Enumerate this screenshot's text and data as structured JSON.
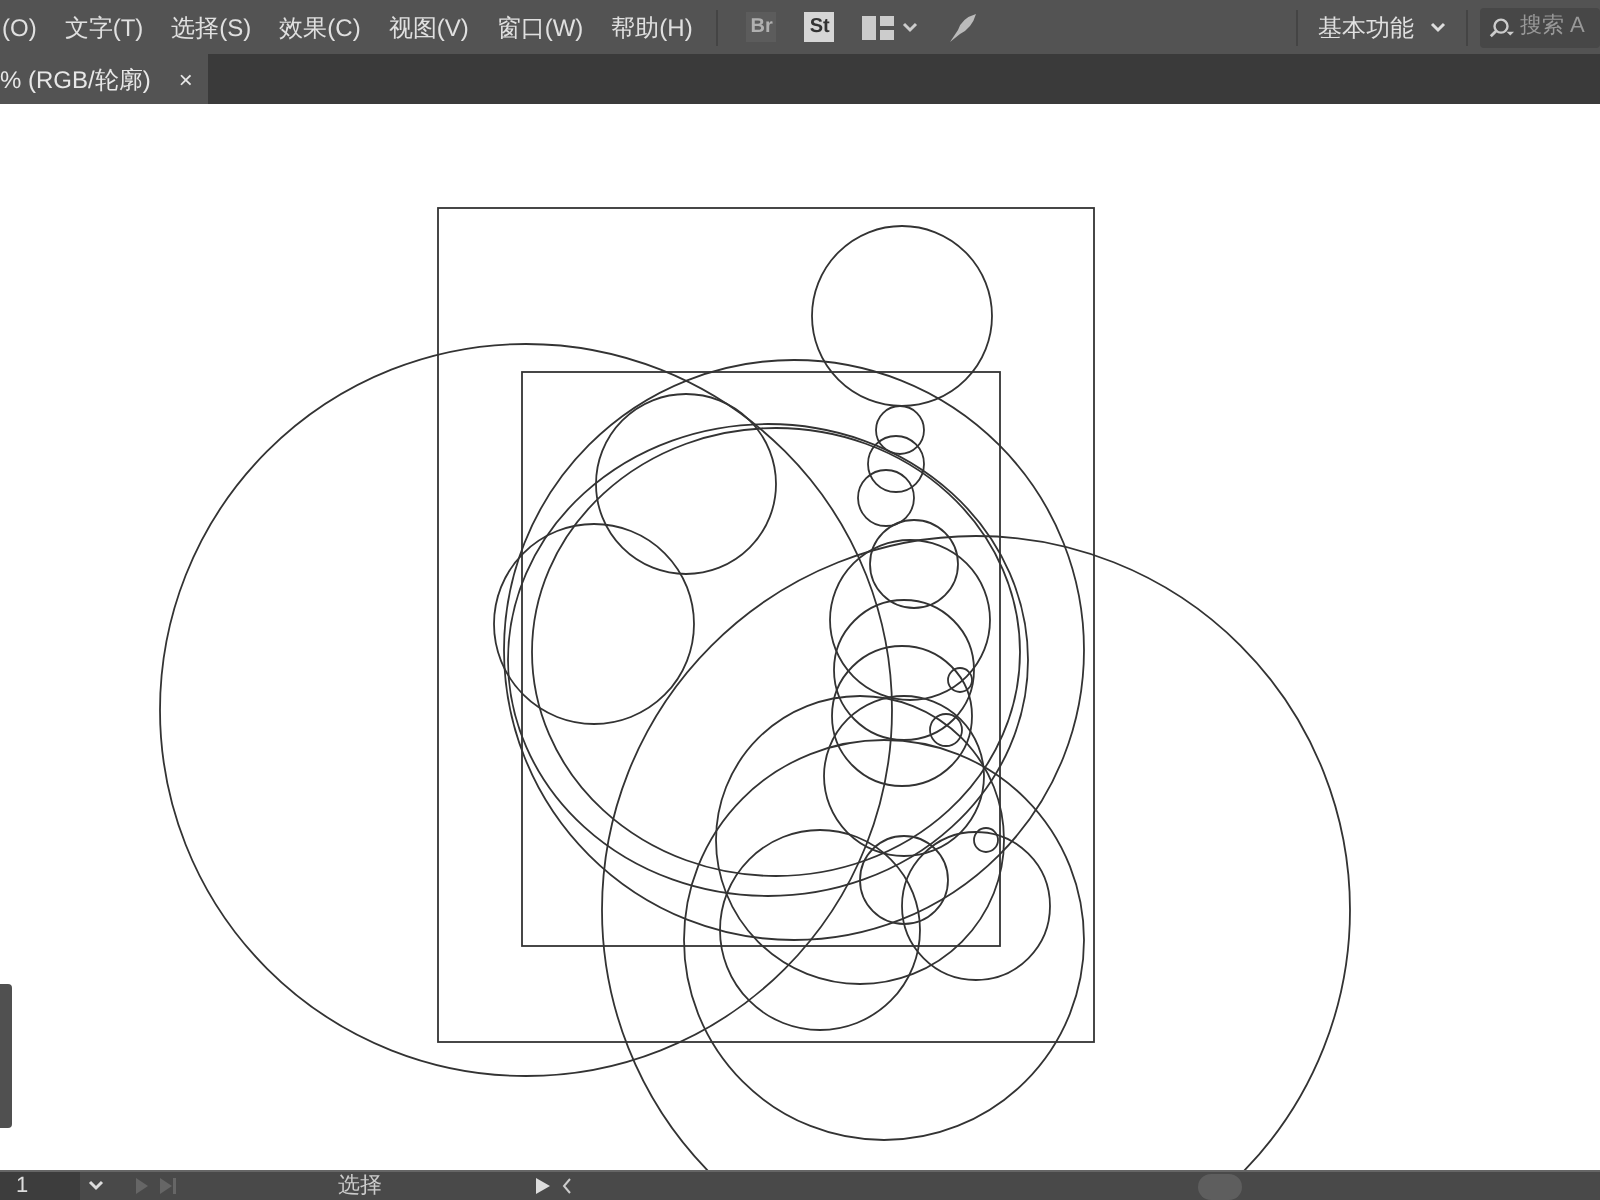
{
  "menu_bar": {
    "items": [
      "(O)",
      "文字(T)",
      "选择(S)",
      "效果(C)",
      "视图(V)",
      "窗口(W)",
      "帮助(H)"
    ],
    "app_icons": [
      {
        "label": "Br",
        "disabled": true
      },
      {
        "label": "St",
        "disabled": false
      }
    ],
    "workspace": "基本功能",
    "search": {
      "placeholder": "搜索 A"
    }
  },
  "tabs": [
    {
      "label": "% (RGB/轮廓)",
      "close": "×",
      "selected": true
    }
  ],
  "status_bar": {
    "artboard": "1",
    "tool": "选择"
  }
}
